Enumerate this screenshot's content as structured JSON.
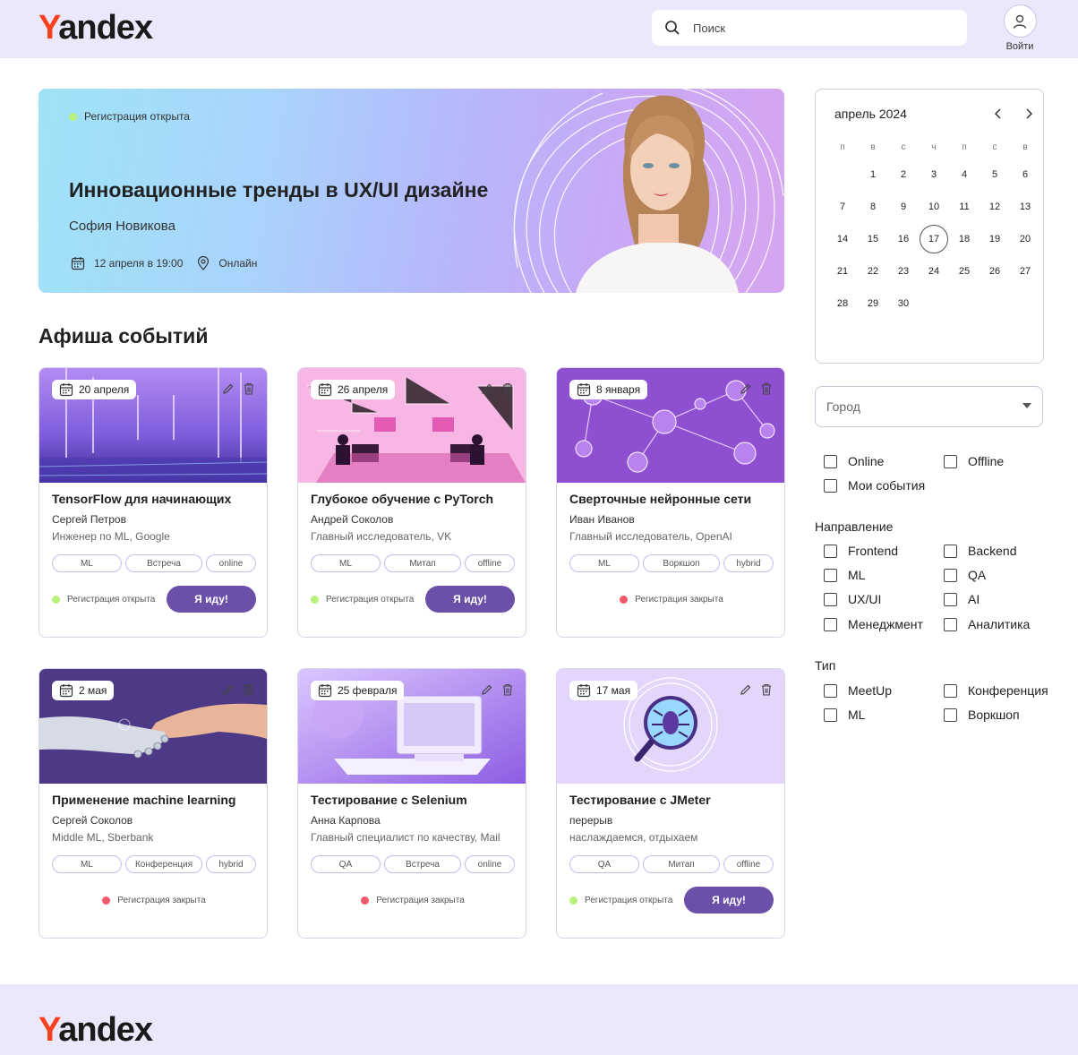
{
  "header": {
    "logo_first": "Y",
    "logo_rest": "andex",
    "search_placeholder": "Поиск",
    "login_label": "Войти"
  },
  "hero": {
    "status": "Регистрация открыта",
    "title": "Инновационные тренды в UX/UI дизайне",
    "speaker": "София Новикова",
    "date": "12 апреля в 19:00",
    "location": "Онлайн"
  },
  "section_title": "Афиша событий",
  "cards": [
    {
      "date": "20 апреля",
      "title": "TensorFlow для начинающих",
      "speaker": "Сергей Петров",
      "role": "Инженер по ML, Google",
      "tags": [
        "ML",
        "Встреча",
        "online"
      ],
      "status": "Регистрация открыта",
      "open": true,
      "button": "Я иду!"
    },
    {
      "date": "26 апреля",
      "title": "Глубокое обучение с PyTorch",
      "speaker": "Андрей Соколов",
      "role": "Главный исследователь, VK",
      "tags": [
        "ML",
        "Митап",
        "offline"
      ],
      "status": "Регистрация открыта",
      "open": true,
      "button": "Я иду!"
    },
    {
      "date": "8 января",
      "title": "Сверточные нейронные сети",
      "speaker": "Иван Иванов",
      "role": "Главный исследователь, OpenAI",
      "tags": [
        "ML",
        "Воркшоп",
        "hybrid"
      ],
      "status": "Регистрация закрыта",
      "open": false
    },
    {
      "date": "2 мая",
      "title": "Применение machine learning",
      "speaker": "Сергей Соколов",
      "role": "Middle ML, Sberbank",
      "tags": [
        "ML",
        "Конференция",
        "hybrid"
      ],
      "status": "Регистрация закрыта",
      "open": false
    },
    {
      "date": "25 февраля",
      "title": "Тестирование с Selenium",
      "speaker": "Анна Карпова",
      "role": "Главный специалист по качеству, Mail",
      "tags": [
        "QA",
        "Встреча",
        "online"
      ],
      "status": "Регистрация закрыта",
      "open": false
    },
    {
      "date": "17 мая",
      "title": "Тестирование с JMeter",
      "speaker": "перерыв",
      "role": "наслаждаемся, отдыхаем",
      "tags": [
        "QA",
        "Митап",
        "offline"
      ],
      "status": "Регистрация открыта",
      "open": true,
      "button": "Я иду!"
    }
  ],
  "calendar": {
    "month": "апрель 2024",
    "weekdays": [
      "п",
      "в",
      "с",
      "ч",
      "п",
      "с",
      "в"
    ],
    "weeks": [
      [
        "",
        "1",
        "2",
        "3",
        "4",
        "5",
        "6"
      ],
      [
        "7",
        "8",
        "9",
        "10",
        "11",
        "12",
        "13"
      ],
      [
        "14",
        "15",
        "16",
        "17",
        "18",
        "19",
        "20"
      ],
      [
        "21",
        "22",
        "23",
        "24",
        "25",
        "26",
        "27"
      ],
      [
        "28",
        "29",
        "30",
        "",
        "",
        "",
        ""
      ]
    ],
    "selected": "17"
  },
  "filters": {
    "city_placeholder": "Город",
    "format": [
      "Online",
      "Offline",
      "Мои события"
    ],
    "direction_label": "Направление",
    "direction": [
      "Frontend",
      "Backend",
      "ML",
      "QA",
      "UX/UI",
      "AI",
      "Менеджмент",
      "Аналитика"
    ],
    "type_label": "Тип",
    "type": [
      "MeetUp",
      "Конференция",
      "ML",
      "Воркшоп"
    ]
  },
  "colors": {
    "brand_red": "#fc3f1d",
    "accent_purple": "#6b4fa8",
    "status_open": "#b9f27a",
    "status_closed": "#f2576b",
    "header_bg": "#ebe8fb"
  }
}
